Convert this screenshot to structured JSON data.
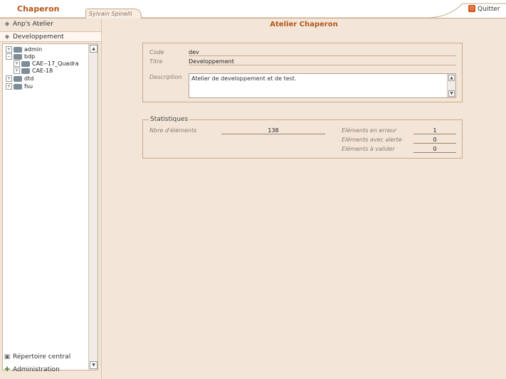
{
  "app": {
    "brand": "Chaperon",
    "user_tab": "Sylvain Spinelli",
    "quit_label": "Quitter"
  },
  "sidebar": {
    "workspace_label": "Anp's Atelier",
    "current_label": "Developpement",
    "tree": [
      {
        "label": "admin",
        "toggle": "+",
        "level": 0
      },
      {
        "label": "bdp",
        "toggle": "−",
        "level": 0
      },
      {
        "label": "CAE--17_Quadra",
        "toggle": "+",
        "level": 1
      },
      {
        "label": "CAE-18",
        "toggle": "+",
        "level": 1
      },
      {
        "label": "dtd",
        "toggle": "+",
        "level": 0
      },
      {
        "label": "fsu",
        "toggle": "+",
        "level": 0
      }
    ],
    "central_label": "Répertoire central",
    "admin_label": "Administration"
  },
  "main": {
    "title": "Atelier Chaperon",
    "code_label": "Code",
    "code_value": "dev",
    "title_label": "Titre",
    "title_value": "Developpement",
    "description_label": "Description",
    "description_value": "Atelier de developpement et de test."
  },
  "stats": {
    "legend": "Statistiques",
    "nbre_label": "Nbre d'éléments",
    "nbre_value": "138",
    "erreur_label": "Eléments en erreur",
    "erreur_value": "1",
    "alerte_label": "Eléments avec alerte",
    "alerte_value": "0",
    "valider_label": "Eléments à valider",
    "valider_value": "0"
  }
}
